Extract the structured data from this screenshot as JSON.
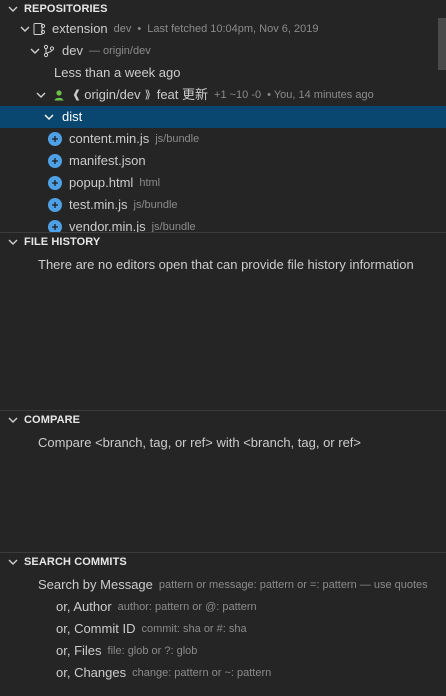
{
  "sections": {
    "repositories": {
      "title": "REPOSITORIES",
      "repo": {
        "name": "extension",
        "branch": "dev",
        "fetched": "Last fetched 10:04pm, Nov 6, 2019"
      },
      "branch": {
        "name": "dev",
        "upstream": "— origin/dev"
      },
      "group": "Less than a week ago",
      "commit": {
        "ref": "origin/dev",
        "arrow": "⟫",
        "message": "feat 更新",
        "stats": "+1 ~10 -0",
        "meta": "• You, 14 minutes ago"
      },
      "folder": "dist",
      "files": [
        {
          "name": "content.min.js",
          "path": "js/bundle"
        },
        {
          "name": "manifest.json",
          "path": ""
        },
        {
          "name": "popup.html",
          "path": "html"
        },
        {
          "name": "test.min.js",
          "path": "js/bundle"
        },
        {
          "name": "vendor.min.js",
          "path": "js/bundle"
        }
      ]
    },
    "file_history": {
      "title": "FILE HISTORY",
      "message": "There are no editors open that can provide file history information"
    },
    "compare": {
      "title": "COMPARE",
      "message": "Compare <branch, tag, or ref> with <branch, tag, or ref>"
    },
    "search_commits": {
      "title": "SEARCH COMMITS",
      "items": [
        {
          "label": "Search by Message",
          "hint": "pattern or message: pattern or =: pattern — use quotes"
        },
        {
          "label": "or, Author",
          "hint": "author: pattern or @: pattern"
        },
        {
          "label": "or, Commit ID",
          "hint": "commit: sha or #: sha"
        },
        {
          "label": "or, Files",
          "hint": "file: glob or ?: glob"
        },
        {
          "label": "or, Changes",
          "hint": "change: pattern or ~: pattern"
        }
      ]
    }
  },
  "colors": {
    "background": "#252526",
    "selection": "#094771",
    "accent": "#4ea1e6"
  }
}
